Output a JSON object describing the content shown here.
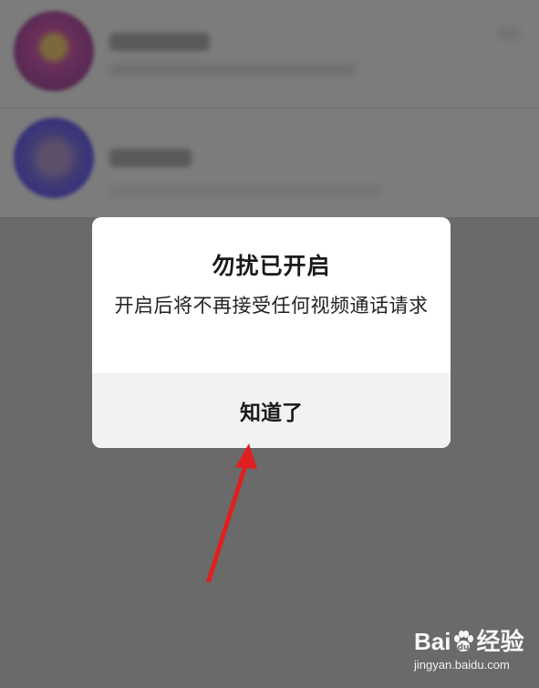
{
  "dialog": {
    "title": "勿扰已开启",
    "message": "开启后将不再接受任何视频通话请求",
    "confirm_label": "知道了"
  },
  "annotation": {
    "arrow_color": "#e02020"
  },
  "watermark": {
    "brand_left": "Bai",
    "brand_right": "经验",
    "url": "jingyan.baidu.com"
  },
  "colors": {
    "overlay": "#6a6a6a",
    "dialog_bg": "#ffffff",
    "footer_bg": "#f2f2f2"
  }
}
